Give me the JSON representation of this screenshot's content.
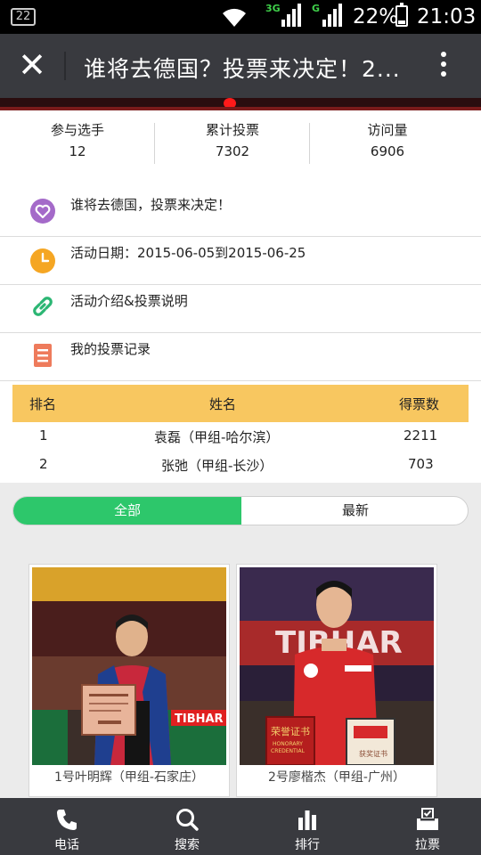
{
  "status_bar": {
    "notification_count": "22",
    "network_1": "3G",
    "network_2": "G",
    "battery": "22%",
    "battery_level": 0.22,
    "time": "21:03"
  },
  "app_bar": {
    "title": "谁将去德国？投票来决定！2...",
    "close_icon": "close-icon",
    "more_icon": "more-vert-icon"
  },
  "stats": [
    {
      "label": "参与选手",
      "value": "12"
    },
    {
      "label": "累计投票",
      "value": "7302"
    },
    {
      "label": "访问量",
      "value": "6906"
    }
  ],
  "info": {
    "title": {
      "icon": "heart-icon",
      "text": "谁将去德国，投票来决定！",
      "color": "#a46ac9"
    },
    "date": {
      "icon": "clock-icon",
      "text": "活动日期：2015-06-05到2015-06-25",
      "color": "#f5a623"
    },
    "intro": {
      "icon": "link-icon",
      "text": "活动介绍&投票说明",
      "color": "#2bb673"
    },
    "records": {
      "icon": "list-icon",
      "text": "我的投票记录",
      "color": "#ee7b5c"
    }
  },
  "ranking": {
    "headers": {
      "rank": "排名",
      "name": "姓名",
      "votes": "得票数"
    },
    "rows": [
      {
        "rank": "1",
        "name": "袁磊（甲组-哈尔滨）",
        "votes": "2211"
      },
      {
        "rank": "2",
        "name": "张弛（甲组-长沙）",
        "votes": "703"
      }
    ],
    "header_color": "#f8c760"
  },
  "tabs": {
    "all": "全部",
    "latest": "最新",
    "active_color": "#2dc76b"
  },
  "candidates": [
    {
      "caption": "1号叶明辉（甲组-石家庄）"
    },
    {
      "caption": "2号廖楷杰（甲组-广州）"
    }
  ],
  "photo_text": {
    "tibhar": "TIBHAR",
    "cert_cn": "荣誉证书",
    "cert_en_1": "HONORARY",
    "cert_en_2": "CREDENTIAL",
    "cert_small": "获奖证书"
  },
  "bottom_nav": [
    {
      "label": "电话",
      "icon": "phone-icon"
    },
    {
      "label": "搜索",
      "icon": "search-icon"
    },
    {
      "label": "排行",
      "icon": "bar-chart-icon"
    },
    {
      "label": "拉票",
      "icon": "ballot-box-icon"
    }
  ]
}
